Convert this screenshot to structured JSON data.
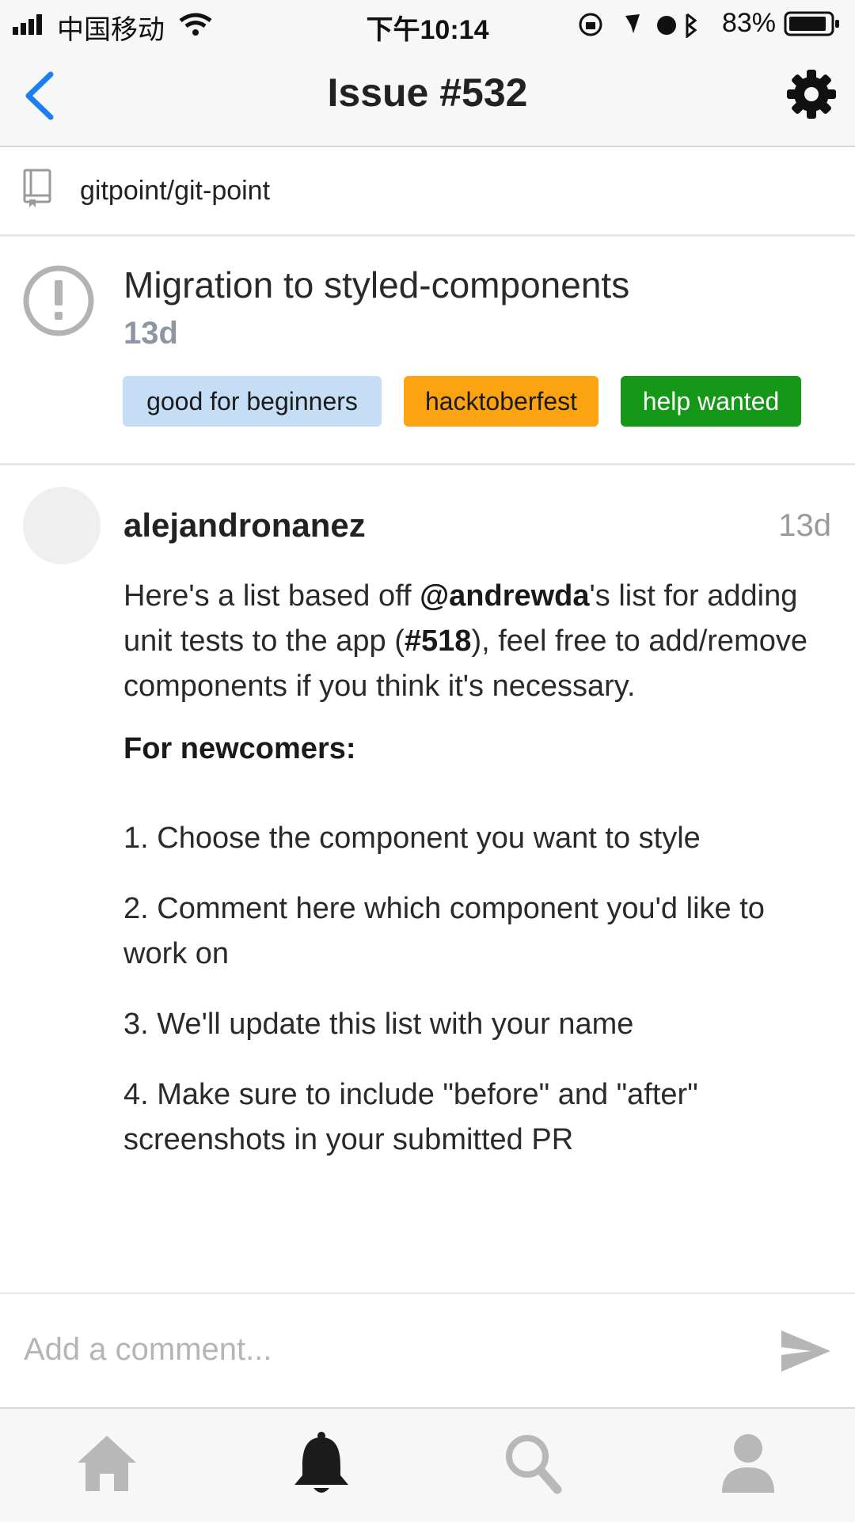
{
  "status_bar": {
    "carrier": "中国移动",
    "time": "下午10:14",
    "battery": "83%"
  },
  "nav": {
    "title": "Issue #532"
  },
  "repo": {
    "name": "gitpoint/git-point"
  },
  "issue": {
    "title": "Migration to styled-components",
    "age": "13d",
    "labels": [
      {
        "text": "good for beginners",
        "bg": "#c5def5",
        "fg": "#1b1b1b"
      },
      {
        "text": "hacktoberfest",
        "bg": "#fca311",
        "fg": "#1b1b1b"
      },
      {
        "text": "help wanted",
        "bg": "#159818",
        "fg": "#ffffff"
      }
    ]
  },
  "comment": {
    "author": "alejandronanez",
    "age": "13d",
    "intro": {
      "pre": "Here's a list based off ",
      "mention": "@andrewda",
      "mid": "'s list for adding unit tests to the app (",
      "ref": "#518",
      "post": "), feel free to add/remove components if you think it's necessary."
    },
    "heading": "For newcomers:",
    "steps": [
      "1. Choose the component you want to style",
      "2. Comment here which component you'd like to work on",
      "3. We'll update this list with your name",
      "4. Make sure to include \"before\" and \"after\" screenshots in your submitted PR"
    ]
  },
  "composer": {
    "placeholder": "Add a comment..."
  },
  "colors": {
    "accent": "#1a7ff0",
    "active_tab": "#1b1b1b",
    "inactive_tab": "#b8b8b8"
  },
  "tabs": [
    "home-icon",
    "bell-icon",
    "search-icon",
    "profile-icon"
  ]
}
